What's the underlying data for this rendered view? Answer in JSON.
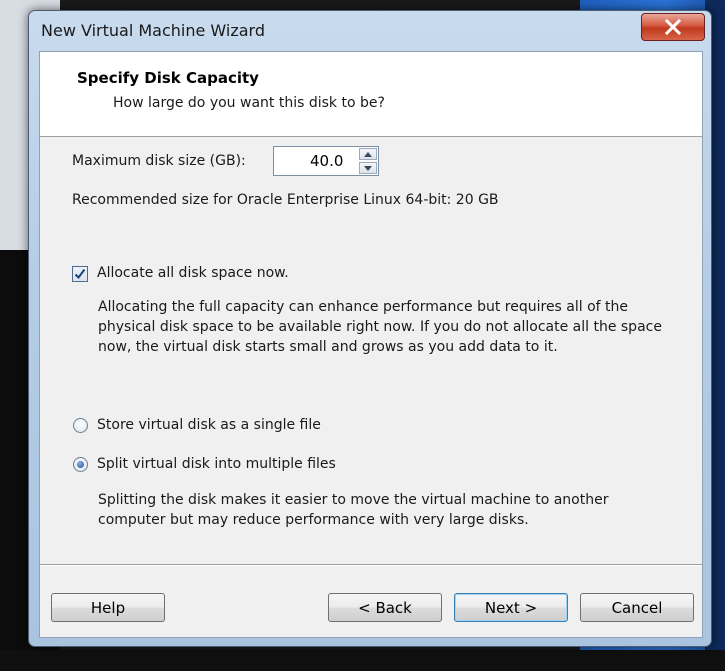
{
  "window": {
    "title": "New Virtual Machine Wizard"
  },
  "header": {
    "title": "Specify Disk Capacity",
    "subtitle": "How large do you want this disk to be?"
  },
  "disk_size": {
    "label": "Maximum disk size (GB):",
    "value": "40.0"
  },
  "recommended": "Recommended size for Oracle Enterprise Linux 64-bit: 20 GB",
  "allocate": {
    "label": "Allocate all disk space now.",
    "checked": true,
    "description": "Allocating the full capacity can enhance performance but requires all of the physical disk space to be available right now. If you do not allocate all the space now, the virtual disk starts small and grows as you add data to it."
  },
  "storage_options": [
    {
      "label": "Store virtual disk as a single file",
      "selected": false
    },
    {
      "label": "Split virtual disk into multiple files",
      "selected": true
    }
  ],
  "split_description": "Splitting the disk makes it easier to move the virtual machine to another computer but may reduce performance with very large disks.",
  "buttons": {
    "help": "Help",
    "back": "< Back",
    "next": "Next >",
    "cancel": "Cancel"
  },
  "colors": {
    "accent_focus": "#3c7fb1",
    "close_red": "#c0391e",
    "titlebar": "#b5cde6"
  }
}
